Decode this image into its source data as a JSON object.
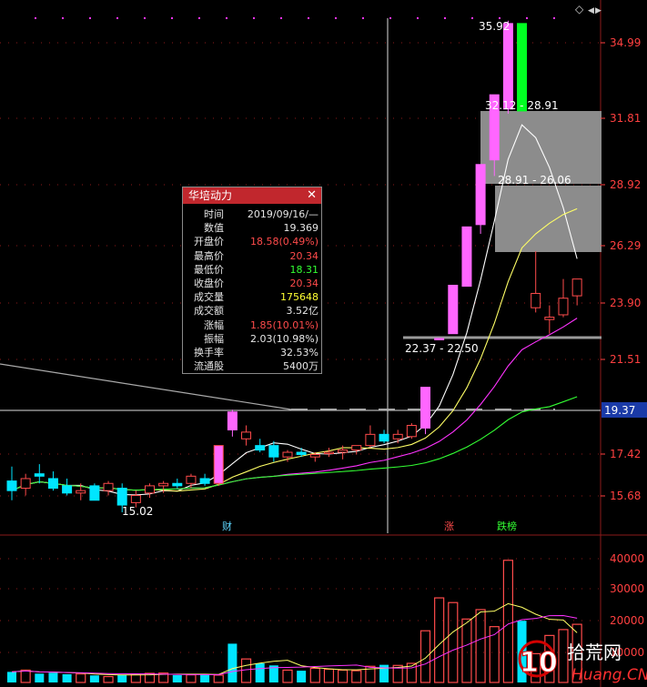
{
  "colors": {
    "up": "#ff4b4b",
    "down": "#00e5ff",
    "pink": "#ff66ff",
    "green_bar": "#00ff22",
    "axis_text": "#ff4040",
    "white": "#ffffff",
    "ma5": "#ffffff",
    "ma10": "#ffff66",
    "ma20": "#ff33ff",
    "ma60": "#33ff33",
    "grid": "#8b1a1a",
    "gray_box": "#8c8c8c"
  },
  "toolbar": {
    "diamond_icon": "◇",
    "arrow_left": "◀",
    "arrow_right": "▶"
  },
  "price_axis": {
    "labels": [
      "34.99",
      "31.81",
      "28.92",
      "26.29",
      "23.90",
      "21.51",
      "19.37",
      "17.42",
      "15.68"
    ],
    "current_label": "19.37"
  },
  "volume_axis": {
    "labels": [
      "40000",
      "30000",
      "20000",
      "10000"
    ]
  },
  "annotations": {
    "high_label": "35.92",
    "low_label": "15.02",
    "zone1_label": "32.12 - 28.91",
    "zone2_label": "28.91 - 26.06",
    "zone3_label": "22.37 - 22.50"
  },
  "event_tags": {
    "cai": "财",
    "zhang": "涨",
    "dieban": "跌榜"
  },
  "info_box": {
    "title": "华培动力",
    "close": "✕",
    "rows": [
      {
        "label": "时间",
        "value": "2019/09/16/—",
        "color": "#e6e6e6"
      },
      {
        "label": "数值",
        "value": "19.369",
        "color": "#e6e6e6"
      },
      {
        "label": "开盘价",
        "value": "18.58(0.49%)",
        "color": "#ff4b4b"
      },
      {
        "label": "最高价",
        "value": "20.34",
        "color": "#ff4b4b"
      },
      {
        "label": "最低价",
        "value": "18.31",
        "color": "#33ff33"
      },
      {
        "label": "收盘价",
        "value": "20.34",
        "color": "#ff4b4b"
      },
      {
        "label": "成交量",
        "value": "175648",
        "color": "#ffff33"
      },
      {
        "label": "成交额",
        "value": "3.52亿",
        "color": "#e6e6e6"
      },
      {
        "label": "涨幅",
        "value": "1.85(10.01%)",
        "color": "#ff4b4b"
      },
      {
        "label": "振幅",
        "value": "2.03(10.98%)",
        "color": "#e6e6e6"
      },
      {
        "label": "换手率",
        "value": "32.53%",
        "color": "#e6e6e6"
      },
      {
        "label": "流通股",
        "value": "5400万",
        "color": "#e6e6e6"
      }
    ]
  },
  "watermark": {
    "number": "10",
    "text": "拾荒网",
    "url": "Huang.CN"
  },
  "chart_data": {
    "type": "candlestick",
    "candles": [
      {
        "o": 16.3,
        "h": 16.9,
        "l": 15.5,
        "c": 15.9
      },
      {
        "o": 16.0,
        "h": 16.6,
        "l": 15.7,
        "c": 16.4
      },
      {
        "o": 16.6,
        "h": 17.0,
        "l": 16.2,
        "c": 16.5
      },
      {
        "o": 16.4,
        "h": 16.7,
        "l": 15.9,
        "c": 16.0
      },
      {
        "o": 16.1,
        "h": 16.4,
        "l": 15.7,
        "c": 15.8
      },
      {
        "o": 15.8,
        "h": 16.2,
        "l": 15.5,
        "c": 15.9
      },
      {
        "o": 16.1,
        "h": 16.2,
        "l": 15.6,
        "c": 15.5
      },
      {
        "o": 15.9,
        "h": 16.3,
        "l": 15.7,
        "c": 16.2
      },
      {
        "o": 16.0,
        "h": 16.2,
        "l": 15.0,
        "c": 15.3
      },
      {
        "o": 15.4,
        "h": 15.9,
        "l": 15.2,
        "c": 15.7
      },
      {
        "o": 15.8,
        "h": 16.2,
        "l": 15.6,
        "c": 16.1
      },
      {
        "o": 16.1,
        "h": 16.3,
        "l": 15.8,
        "c": 16.2
      },
      {
        "o": 16.2,
        "h": 16.4,
        "l": 16.0,
        "c": 16.1
      },
      {
        "o": 16.2,
        "h": 16.6,
        "l": 16.0,
        "c": 16.5
      },
      {
        "o": 16.4,
        "h": 16.6,
        "l": 16.1,
        "c": 16.2
      },
      {
        "o": 16.2,
        "h": 17.8,
        "l": 16.1,
        "c": 17.8
      },
      {
        "o": 19.3,
        "h": 19.4,
        "l": 18.2,
        "c": 18.5
      },
      {
        "o": 18.1,
        "h": 18.7,
        "l": 17.8,
        "c": 18.4
      },
      {
        "o": 17.8,
        "h": 18.1,
        "l": 17.5,
        "c": 17.6
      },
      {
        "o": 17.8,
        "h": 18.0,
        "l": 17.1,
        "c": 17.3
      },
      {
        "o": 17.3,
        "h": 17.6,
        "l": 17.1,
        "c": 17.5
      },
      {
        "o": 17.5,
        "h": 17.7,
        "l": 17.3,
        "c": 17.4
      },
      {
        "o": 17.3,
        "h": 17.5,
        "l": 17.1,
        "c": 17.4
      },
      {
        "o": 17.5,
        "h": 17.7,
        "l": 17.3,
        "c": 17.5
      },
      {
        "o": 17.5,
        "h": 17.8,
        "l": 17.2,
        "c": 17.6
      },
      {
        "o": 17.6,
        "h": 17.8,
        "l": 17.4,
        "c": 17.8
      },
      {
        "o": 17.8,
        "h": 18.7,
        "l": 17.7,
        "c": 18.3
      },
      {
        "o": 18.3,
        "h": 18.5,
        "l": 17.9,
        "c": 18.0
      },
      {
        "o": 18.1,
        "h": 18.5,
        "l": 17.9,
        "c": 18.3
      },
      {
        "o": 18.2,
        "h": 18.8,
        "l": 18.1,
        "c": 18.7
      },
      {
        "o": 18.58,
        "h": 20.34,
        "l": 18.31,
        "c": 20.34
      },
      {
        "o": 22.37,
        "h": 22.4,
        "l": 22.37,
        "c": 22.4
      },
      {
        "o": 22.6,
        "h": 24.64,
        "l": 22.6,
        "c": 24.64
      },
      {
        "o": 24.6,
        "h": 27.1,
        "l": 24.6,
        "c": 27.1
      },
      {
        "o": 27.2,
        "h": 29.8,
        "l": 26.8,
        "c": 29.8
      },
      {
        "o": 30.0,
        "h": 32.8,
        "l": 29.3,
        "c": 32.8
      },
      {
        "o": 32.2,
        "h": 35.92,
        "l": 32.0,
        "c": 35.8
      },
      {
        "o": 35.8,
        "h": 35.8,
        "l": 32.12,
        "c": 32.12
      },
      {
        "o": 23.7,
        "h": 26.06,
        "l": 23.5,
        "c": 24.3
      },
      {
        "o": 23.2,
        "h": 23.8,
        "l": 22.6,
        "c": 23.3
      },
      {
        "o": 23.4,
        "h": 24.9,
        "l": 23.3,
        "c": 24.1
      },
      {
        "o": 24.2,
        "h": 24.9,
        "l": 23.8,
        "c": 24.9
      }
    ],
    "volume": [
      3600,
      4200,
      3000,
      3300,
      2800,
      2900,
      2400,
      2000,
      2600,
      2800,
      3100,
      3200,
      2500,
      2600,
      2800,
      2500,
      13200,
      8000,
      6500,
      5800,
      4200,
      4000,
      4800,
      4500,
      4200,
      4000,
      5500,
      6000,
      5800,
      6500,
      17600,
      28800,
      27200,
      21600,
      24800,
      19000,
      41600,
      21000,
      9800,
      16000,
      18000,
      19800
    ],
    "ylim": [
      14.8,
      36.4
    ],
    "vol_ylim": [
      0,
      44000
    ]
  }
}
